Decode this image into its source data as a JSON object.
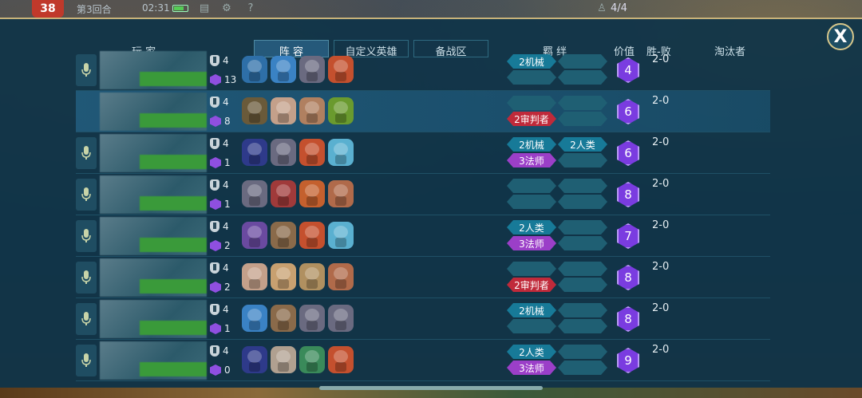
{
  "topbar": {
    "round_number": "38",
    "round_label": "第3回合",
    "clock": "02:31",
    "alive_count": "4/4"
  },
  "close_label": "X",
  "header": {
    "player": "玩 家",
    "tabs": [
      "阵 容",
      "自定义英雄",
      "备战区"
    ],
    "bonds": "羁 绊",
    "value": "价值",
    "record": "胜-败",
    "eliminator": "淘汰者"
  },
  "players": [
    {
      "mic": true,
      "self": false,
      "level": "4",
      "gems": "13",
      "heroes": [
        "#2e6fa8",
        "#3a82c4",
        "#6a6a80",
        "#c4502e"
      ],
      "bonds_left": [
        "2机械",
        ""
      ],
      "bonds_right": [
        "",
        ""
      ],
      "value": "4",
      "record": "2-0"
    },
    {
      "mic": false,
      "self": true,
      "level": "4",
      "gems": "8",
      "heroes": [
        "#6a5a3a",
        "#c4a08a",
        "#b08060",
        "#6a9a2e"
      ],
      "bonds_left": [
        "",
        "2审判者"
      ],
      "bonds_right": [
        "",
        ""
      ],
      "value": "6",
      "record": "2-0"
    },
    {
      "mic": true,
      "self": false,
      "level": "4",
      "gems": "1",
      "heroes": [
        "#2e3a8a",
        "#6a6a80",
        "#c4502e",
        "#5ab0d0"
      ],
      "bonds_left": [
        "2机械",
        "3法师"
      ],
      "bonds_right": [
        "2人类",
        ""
      ],
      "value": "6",
      "record": "2-0"
    },
    {
      "mic": true,
      "self": false,
      "level": "4",
      "gems": "1",
      "heroes": [
        "#6a6a80",
        "#a03a3a",
        "#c4602e",
        "#b06a4a"
      ],
      "bonds_left": [
        "",
        ""
      ],
      "bonds_right": [
        "",
        ""
      ],
      "value": "8",
      "record": "2-0"
    },
    {
      "mic": true,
      "self": false,
      "level": "4",
      "gems": "2",
      "heroes": [
        "#6a4aa0",
        "#8a6a4a",
        "#c4502e",
        "#5ab0d0"
      ],
      "bonds_left": [
        "2人类",
        "3法师"
      ],
      "bonds_right": [
        "",
        ""
      ],
      "value": "7",
      "record": "2-0"
    },
    {
      "mic": true,
      "self": false,
      "level": "4",
      "gems": "2",
      "heroes": [
        "#c4a08a",
        "#c8a070",
        "#b09060",
        "#b06a4a"
      ],
      "bonds_left": [
        "",
        "2审判者"
      ],
      "bonds_right": [
        "",
        ""
      ],
      "value": "8",
      "record": "2-0"
    },
    {
      "mic": true,
      "self": false,
      "level": "4",
      "gems": "1",
      "heroes": [
        "#3a82c4",
        "#8a6a4a",
        "#6a6a80",
        "#6a6a80"
      ],
      "bonds_left": [
        "2机械",
        ""
      ],
      "bonds_right": [
        "",
        ""
      ],
      "value": "8",
      "record": "2-0"
    },
    {
      "mic": true,
      "self": false,
      "level": "4",
      "gems": "0",
      "heroes": [
        "#2e3a8a",
        "#b0a090",
        "#3a8a5a",
        "#c4502e"
      ],
      "bonds_left": [
        "2人类",
        "3法师"
      ],
      "bonds_right": [
        "",
        ""
      ],
      "value": "9",
      "record": "2-0"
    }
  ],
  "colors": {
    "panel": "#10344a",
    "accent_gold": "#c8b37a",
    "gem_purple": "#8f4fe0",
    "bond_blue": "#177a98",
    "bond_purple": "#9b3fc8",
    "bond_red": "#c02a3a"
  }
}
